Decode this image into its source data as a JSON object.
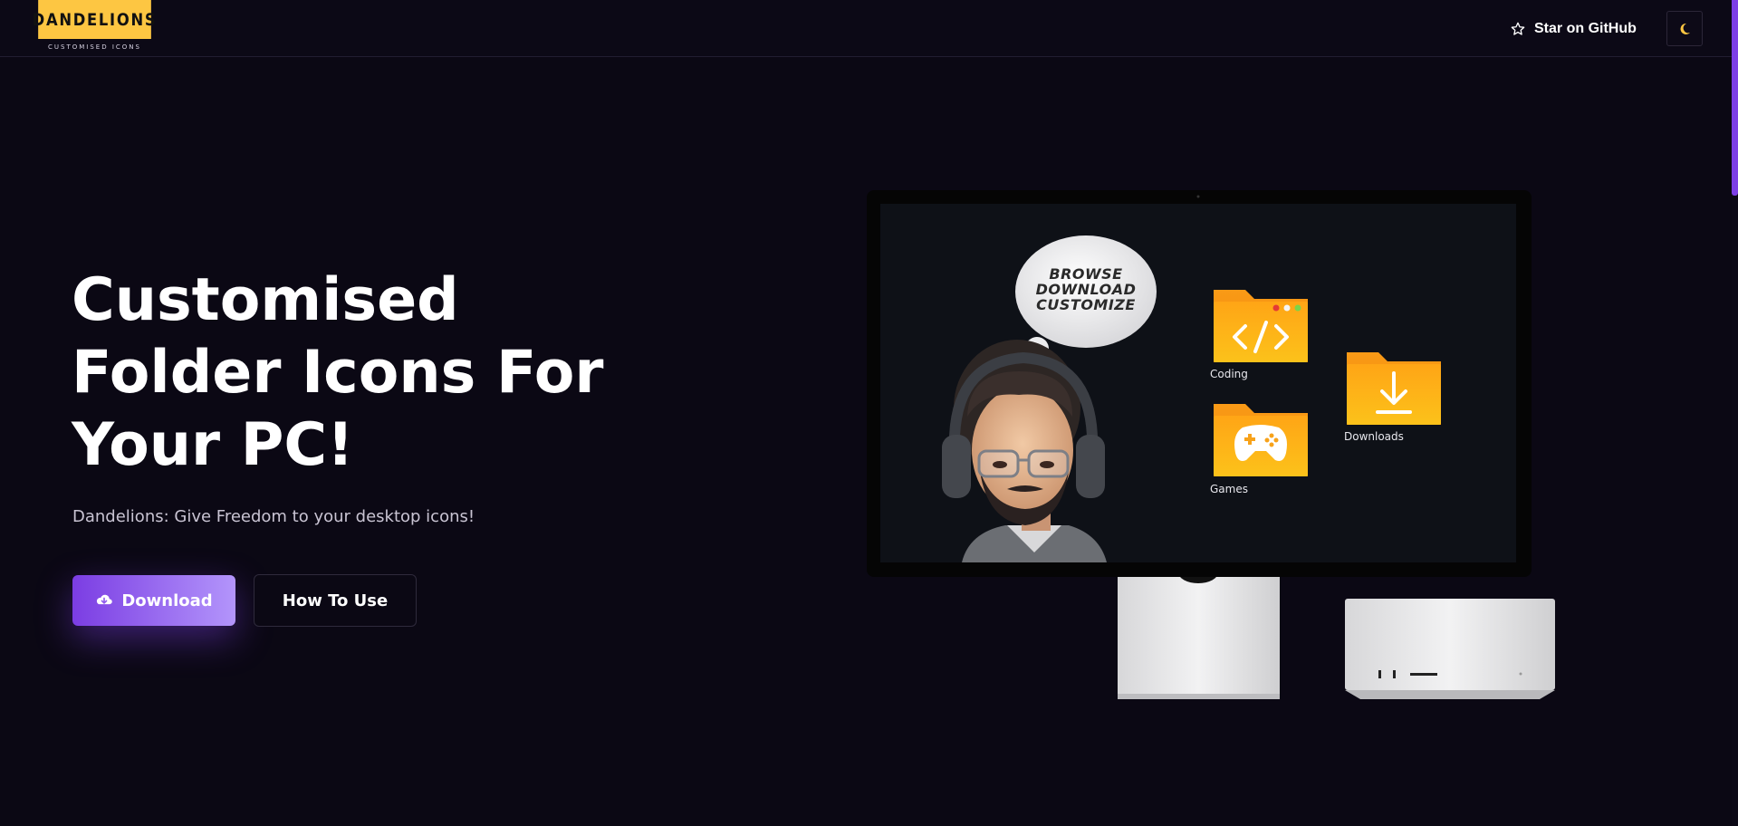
{
  "header": {
    "logo_title": "DANDELIONS",
    "logo_subtitle": "CUSTOMISED ICONS",
    "github_label": "Star on GitHub",
    "star_icon": "star-icon",
    "theme_icon": "moon-icon"
  },
  "hero": {
    "title_lines": [
      "Customised",
      "Folder Icons For",
      "Your PC!"
    ],
    "tagline": "Dandelions: Give Freedom to your desktop icons!",
    "download_label": "Download",
    "download_icon": "cloud-download-icon",
    "howto_label": "How To Use"
  },
  "illustration": {
    "bubble_lines": [
      "BROWSE",
      "DOWNLOAD",
      "CUSTOMIZE"
    ],
    "folders": [
      {
        "label": "Coding",
        "icon": "code-icon"
      },
      {
        "label": "Downloads",
        "icon": "download-arrow-icon"
      },
      {
        "label": "Games",
        "icon": "gamepad-icon"
      }
    ]
  },
  "colors": {
    "background": "#0b0814",
    "accent": "#7b3de3",
    "accent_light": "#b395fb",
    "logo_yellow": "#fdc642",
    "folder_orange": "#fca311"
  }
}
